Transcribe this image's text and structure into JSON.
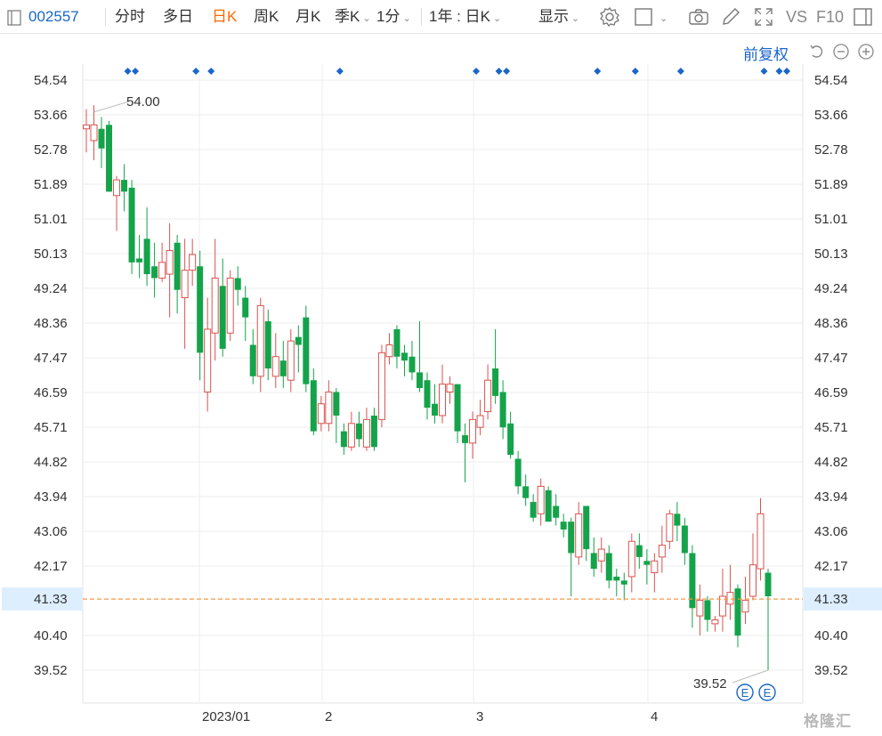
{
  "toolbar": {
    "stock_code": "002557",
    "items": [
      {
        "label": "分时"
      },
      {
        "label": "多日"
      },
      {
        "label": "日K",
        "active": true
      },
      {
        "label": "周K"
      },
      {
        "label": "月K"
      },
      {
        "label": "季K"
      },
      {
        "label": "1分"
      },
      {
        "label": "1年 : 日K"
      },
      {
        "label": "显示"
      },
      {
        "label": "VS"
      },
      {
        "label": "F10"
      }
    ]
  },
  "adjust_label": "前复权",
  "watermark": "格隆汇",
  "colors": {
    "up": "#d9534f",
    "down": "#14a34a",
    "accent_blue": "#1a66c8",
    "price_line": "#f39a4a",
    "price_tag_bg": "#ddeeff"
  },
  "chart_data": {
    "type": "candlestick",
    "y_ticks": [
      "54.54",
      "53.66",
      "52.78",
      "51.89",
      "51.01",
      "50.13",
      "49.24",
      "48.36",
      "47.47",
      "46.59",
      "45.71",
      "44.82",
      "43.94",
      "43.06",
      "42.17",
      "41.33",
      "40.40",
      "39.52"
    ],
    "ylim": [
      39.52,
      54.54
    ],
    "x_labels": [
      "2023/01",
      "2",
      "3",
      "4"
    ],
    "current_price": "41.33",
    "max_label": "54.00",
    "min_label": "39.52",
    "event_markers": [
      "E",
      "E"
    ],
    "candles": [
      {
        "o": 53.3,
        "c": 53.4,
        "h": 53.8,
        "l": 52.7
      },
      {
        "o": 53.0,
        "c": 53.4,
        "h": 53.9,
        "l": 52.5
      },
      {
        "o": 53.3,
        "c": 52.8,
        "h": 53.6,
        "l": 52.3
      },
      {
        "o": 53.4,
        "c": 51.7,
        "h": 53.5,
        "l": 51.7
      },
      {
        "o": 51.6,
        "c": 52.0,
        "h": 52.1,
        "l": 50.7
      },
      {
        "o": 52.0,
        "c": 51.7,
        "h": 52.4,
        "l": 51.2
      },
      {
        "o": 51.8,
        "c": 49.9,
        "h": 52.0,
        "l": 49.6
      },
      {
        "o": 50.0,
        "c": 49.9,
        "h": 50.6,
        "l": 49.5
      },
      {
        "o": 50.5,
        "c": 49.6,
        "h": 51.3,
        "l": 49.3
      },
      {
        "o": 49.8,
        "c": 49.5,
        "h": 50.4,
        "l": 49.0
      },
      {
        "o": 49.5,
        "c": 49.9,
        "h": 50.4,
        "l": 49.4
      },
      {
        "o": 49.6,
        "c": 50.2,
        "h": 50.9,
        "l": 48.5
      },
      {
        "o": 50.4,
        "c": 49.2,
        "h": 50.6,
        "l": 48.6
      },
      {
        "o": 49.0,
        "c": 49.7,
        "h": 50.5,
        "l": 47.7
      },
      {
        "o": 49.7,
        "c": 50.1,
        "h": 50.5,
        "l": 49.3
      },
      {
        "o": 49.8,
        "c": 47.6,
        "h": 50.2,
        "l": 46.9
      },
      {
        "o": 46.6,
        "c": 48.2,
        "h": 49.0,
        "l": 46.1
      },
      {
        "o": 48.1,
        "c": 49.5,
        "h": 50.5,
        "l": 47.4
      },
      {
        "o": 49.3,
        "c": 47.7,
        "h": 50.0,
        "l": 47.5
      },
      {
        "o": 48.1,
        "c": 49.5,
        "h": 49.7,
        "l": 47.9
      },
      {
        "o": 49.5,
        "c": 49.2,
        "h": 49.8,
        "l": 48.8
      },
      {
        "o": 49.0,
        "c": 48.5,
        "h": 49.3,
        "l": 47.9
      },
      {
        "o": 47.8,
        "c": 47.0,
        "h": 48.2,
        "l": 46.8
      },
      {
        "o": 47.0,
        "c": 48.8,
        "h": 49.0,
        "l": 46.6
      },
      {
        "o": 48.4,
        "c": 47.2,
        "h": 48.7,
        "l": 46.9
      },
      {
        "o": 47.0,
        "c": 47.5,
        "h": 48.1,
        "l": 46.7
      },
      {
        "o": 47.4,
        "c": 47.0,
        "h": 47.9,
        "l": 46.7
      },
      {
        "o": 46.9,
        "c": 47.9,
        "h": 48.2,
        "l": 46.6
      },
      {
        "o": 48.0,
        "c": 47.8,
        "h": 48.3,
        "l": 47.1
      },
      {
        "o": 48.5,
        "c": 46.8,
        "h": 48.8,
        "l": 46.6
      },
      {
        "o": 46.9,
        "c": 45.6,
        "h": 47.2,
        "l": 45.5
      },
      {
        "o": 45.8,
        "c": 46.3,
        "h": 46.5,
        "l": 45.6
      },
      {
        "o": 45.8,
        "c": 46.6,
        "h": 46.9,
        "l": 45.6
      },
      {
        "o": 46.6,
        "c": 46.0,
        "h": 46.7,
        "l": 45.3
      },
      {
        "o": 45.6,
        "c": 45.2,
        "h": 45.8,
        "l": 45.0
      },
      {
        "o": 45.2,
        "c": 45.8,
        "h": 46.1,
        "l": 45.1
      },
      {
        "o": 45.8,
        "c": 45.4,
        "h": 46.1,
        "l": 45.2
      },
      {
        "o": 45.2,
        "c": 45.9,
        "h": 46.2,
        "l": 45.1
      },
      {
        "o": 46.0,
        "c": 45.2,
        "h": 46.2,
        "l": 45.1
      },
      {
        "o": 45.9,
        "c": 47.6,
        "h": 47.8,
        "l": 45.7
      },
      {
        "o": 47.5,
        "c": 47.8,
        "h": 48.1,
        "l": 47.3
      },
      {
        "o": 48.2,
        "c": 47.5,
        "h": 48.3,
        "l": 47.2
      },
      {
        "o": 47.6,
        "c": 47.4,
        "h": 47.8,
        "l": 47.0
      },
      {
        "o": 47.5,
        "c": 47.1,
        "h": 47.9,
        "l": 46.9
      },
      {
        "o": 47.1,
        "c": 46.7,
        "h": 48.4,
        "l": 46.6
      },
      {
        "o": 46.9,
        "c": 46.2,
        "h": 47.1,
        "l": 45.9
      },
      {
        "o": 46.3,
        "c": 46.0,
        "h": 46.8,
        "l": 45.8
      },
      {
        "o": 46.0,
        "c": 46.8,
        "h": 47.3,
        "l": 45.8
      },
      {
        "o": 46.6,
        "c": 46.8,
        "h": 47.0,
        "l": 46.3
      },
      {
        "o": 46.8,
        "c": 45.6,
        "h": 46.8,
        "l": 45.3
      },
      {
        "o": 45.5,
        "c": 45.3,
        "h": 45.8,
        "l": 44.3
      },
      {
        "o": 45.3,
        "c": 45.9,
        "h": 46.1,
        "l": 44.9
      },
      {
        "o": 45.7,
        "c": 46.0,
        "h": 46.4,
        "l": 45.5
      },
      {
        "o": 46.1,
        "c": 46.9,
        "h": 47.3,
        "l": 45.9
      },
      {
        "o": 47.2,
        "c": 46.5,
        "h": 48.2,
        "l": 46.3
      },
      {
        "o": 46.6,
        "c": 45.7,
        "h": 46.9,
        "l": 45.4
      },
      {
        "o": 45.8,
        "c": 45.0,
        "h": 46.1,
        "l": 44.9
      },
      {
        "o": 44.9,
        "c": 44.2,
        "h": 45.1,
        "l": 44.0
      },
      {
        "o": 44.2,
        "c": 43.9,
        "h": 44.5,
        "l": 43.7
      },
      {
        "o": 43.8,
        "c": 43.4,
        "h": 44.0,
        "l": 43.3
      },
      {
        "o": 43.5,
        "c": 44.2,
        "h": 44.4,
        "l": 43.2
      },
      {
        "o": 44.1,
        "c": 43.3,
        "h": 44.2,
        "l": 43.3
      },
      {
        "o": 43.7,
        "c": 43.4,
        "h": 44.0,
        "l": 43.2
      },
      {
        "o": 43.3,
        "c": 43.1,
        "h": 43.5,
        "l": 42.9
      },
      {
        "o": 43.3,
        "c": 42.5,
        "h": 43.4,
        "l": 41.4
      },
      {
        "o": 42.4,
        "c": 43.5,
        "h": 43.8,
        "l": 42.2
      },
      {
        "o": 43.7,
        "c": 42.6,
        "h": 43.7,
        "l": 42.3
      },
      {
        "o": 42.5,
        "c": 42.1,
        "h": 42.9,
        "l": 41.9
      },
      {
        "o": 42.3,
        "c": 42.6,
        "h": 42.9,
        "l": 42.0
      },
      {
        "o": 42.5,
        "c": 41.8,
        "h": 42.7,
        "l": 41.6
      },
      {
        "o": 41.9,
        "c": 41.8,
        "h": 42.1,
        "l": 41.4
      },
      {
        "o": 41.8,
        "c": 41.7,
        "h": 42.0,
        "l": 41.3
      },
      {
        "o": 41.9,
        "c": 42.8,
        "h": 43.0,
        "l": 41.5
      },
      {
        "o": 42.7,
        "c": 42.4,
        "h": 43.0,
        "l": 42.1
      },
      {
        "o": 42.3,
        "c": 42.2,
        "h": 42.6,
        "l": 41.7
      },
      {
        "o": 42.0,
        "c": 42.3,
        "h": 42.5,
        "l": 41.5
      },
      {
        "o": 42.4,
        "c": 42.7,
        "h": 43.2,
        "l": 42.0
      },
      {
        "o": 42.8,
        "c": 43.5,
        "h": 43.6,
        "l": 42.6
      },
      {
        "o": 43.5,
        "c": 43.2,
        "h": 43.8,
        "l": 42.8
      },
      {
        "o": 43.2,
        "c": 42.5,
        "h": 43.4,
        "l": 42.2
      },
      {
        "o": 42.5,
        "c": 41.1,
        "h": 42.7,
        "l": 40.6
      },
      {
        "o": 40.9,
        "c": 41.3,
        "h": 41.7,
        "l": 40.4
      },
      {
        "o": 41.3,
        "c": 40.8,
        "h": 41.4,
        "l": 40.5
      },
      {
        "o": 40.7,
        "c": 40.8,
        "h": 40.9,
        "l": 40.5
      },
      {
        "o": 40.9,
        "c": 41.4,
        "h": 42.1,
        "l": 40.5
      },
      {
        "o": 41.2,
        "c": 41.5,
        "h": 42.2,
        "l": 40.8
      },
      {
        "o": 41.6,
        "c": 40.4,
        "h": 41.7,
        "l": 40.1
      },
      {
        "o": 41.0,
        "c": 41.3,
        "h": 41.9,
        "l": 40.7
      },
      {
        "o": 41.4,
        "c": 42.2,
        "h": 43.0,
        "l": 41.3
      },
      {
        "o": 42.1,
        "c": 43.5,
        "h": 43.9,
        "l": 41.8
      },
      {
        "o": 42.0,
        "c": 41.4,
        "h": 42.1,
        "l": 39.52
      }
    ]
  }
}
